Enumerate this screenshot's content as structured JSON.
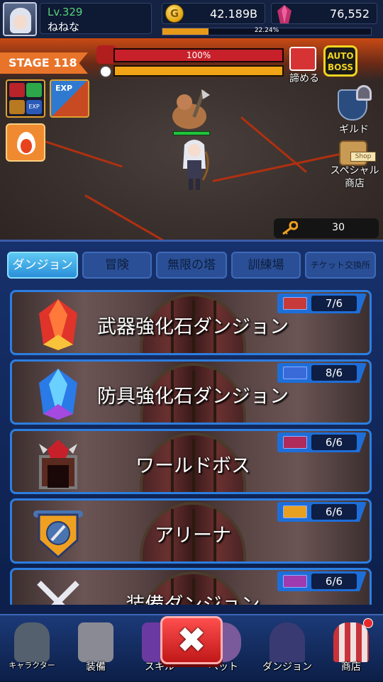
{
  "player": {
    "level": "Lv.329",
    "name": "ねねな"
  },
  "currency": {
    "gold": "42.189B",
    "gold_symbol": "G",
    "gems": "76,552"
  },
  "exp": {
    "percent_text": "22.24%",
    "fraction": 0.2224
  },
  "battle": {
    "stage": "STAGE 118",
    "boss_hp_text": "100%",
    "boss_hp_fraction": 1.0,
    "timer_fraction": 1.0,
    "give_up_label": "諦める",
    "auto_boss_label": "AUTO BOSS",
    "buff2_label": "EXP",
    "buff1_exp_label": "EXP",
    "guild_label": "ギルド",
    "shop_tag": "Shop",
    "special_shop_label_1": "スペシャル",
    "special_shop_label_2": "商店",
    "keys": "30"
  },
  "tabs": [
    {
      "label": "ダンジョン",
      "active": true
    },
    {
      "label": "冒険",
      "active": false
    },
    {
      "label": "無限の塔",
      "active": false
    },
    {
      "label": "訓練場",
      "active": false
    },
    {
      "label": "チケット交換所",
      "active": false
    }
  ],
  "dungeons": [
    {
      "title": "武器強化石ダンジョン",
      "tickets": "7/6",
      "icon": "red-crystal-icon",
      "ticket_color": "#c83a3a"
    },
    {
      "title": "防具強化石ダンジョン",
      "tickets": "8/6",
      "icon": "blue-crystal-icon",
      "ticket_color": "#3a6ad8"
    },
    {
      "title": "ワールドボス",
      "tickets": "6/6",
      "icon": "boss-gate-icon",
      "ticket_color": "#b02a5a"
    },
    {
      "title": "アリーナ",
      "tickets": "6/6",
      "icon": "sword-shield-icon",
      "ticket_color": "#e8a020"
    },
    {
      "title": "装備ダンジョン",
      "tickets": "6/6",
      "icon": "crossed-swords-icon",
      "ticket_color": "#a03ab0"
    }
  ],
  "nav": [
    {
      "label": "キャラクター",
      "icon": "helmet-icon"
    },
    {
      "label": "装備",
      "icon": "equipment-icon"
    },
    {
      "label": "スキル",
      "icon": "skill-book-icon"
    },
    {
      "label": "ペット",
      "icon": "pet-icon"
    },
    {
      "label": "ダンジョン",
      "icon": "dungeon-gate-icon"
    },
    {
      "label": "商店",
      "icon": "store-icon"
    }
  ],
  "close_label": "✖"
}
